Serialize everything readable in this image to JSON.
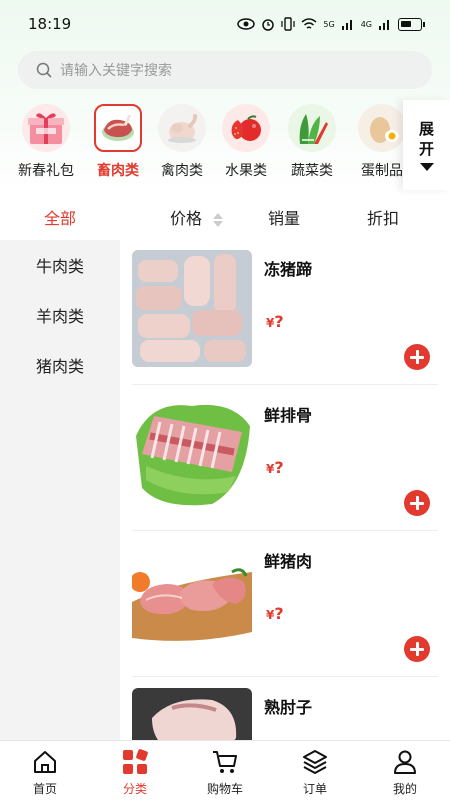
{
  "status_bar": {
    "time": "18:19",
    "net1": "5G",
    "net2": "4G"
  },
  "search": {
    "placeholder": "请输入关键字搜索"
  },
  "categories": [
    {
      "label": "新春礼包",
      "icon": "gift-box-image"
    },
    {
      "label": "畜肉类",
      "icon": "red-meat-image",
      "active": true
    },
    {
      "label": "禽肉类",
      "icon": "poultry-image"
    },
    {
      "label": "水果类",
      "icon": "strawberry-apple-image"
    },
    {
      "label": "蔬菜类",
      "icon": "vegetables-image"
    },
    {
      "label": "蛋制品",
      "icon": "egg-image"
    }
  ],
  "expand": {
    "line1": "展",
    "line2": "开"
  },
  "sort_bar": {
    "all": "全部",
    "price": "价格",
    "sales": "销量",
    "discount": "折扣"
  },
  "sidebar": {
    "items": [
      "牛肉类",
      "羊肉类",
      "猪肉类"
    ]
  },
  "products": [
    {
      "name": "冻猪蹄",
      "currency": "¥",
      "price": "?"
    },
    {
      "name": "鲜排骨",
      "currency": "¥",
      "price": "?"
    },
    {
      "name": "鲜猪肉",
      "currency": "¥",
      "price": "?"
    },
    {
      "name": "熟肘子",
      "currency": "¥",
      "price": "?"
    }
  ],
  "bottom_nav": [
    {
      "label": "首页",
      "icon": "home-icon"
    },
    {
      "label": "分类",
      "icon": "category-icon",
      "active": true
    },
    {
      "label": "购物车",
      "icon": "cart-icon"
    },
    {
      "label": "订单",
      "icon": "order-layers-icon"
    },
    {
      "label": "我的",
      "icon": "user-icon"
    }
  ],
  "colors": {
    "accent": "#e23a2e",
    "sidebar_bg": "#f3f3f3"
  }
}
